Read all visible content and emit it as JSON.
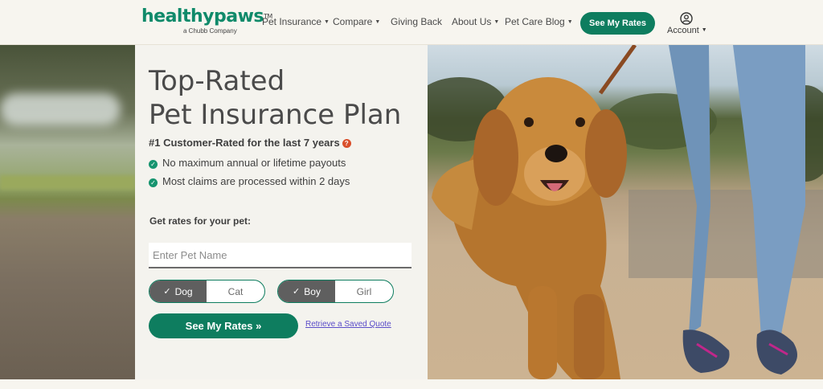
{
  "brand": {
    "logo_text": "healthypaws",
    "logo_tm": "TM",
    "logo_sub": "a Chubb Company"
  },
  "nav": {
    "items": [
      {
        "label": "Pet Insurance",
        "has_caret": true
      },
      {
        "label": "Compare",
        "has_caret": true
      },
      {
        "label": "Giving Back",
        "has_caret": false
      },
      {
        "label": "About Us",
        "has_caret": true
      },
      {
        "label": "Pet Care Blog",
        "has_caret": true
      }
    ],
    "cta_label": "See My Rates",
    "account_label": "Account"
  },
  "hero": {
    "title_line1": "Top-Rated",
    "title_line2": "Pet Insurance Plan",
    "subtitle": "#1 Customer-Rated for the last 7 years",
    "benefits": [
      "No maximum annual or lifetime payouts",
      "Most claims are processed within 2 days"
    ],
    "form_label": "Get rates for your pet:",
    "pet_name_placeholder": "Enter Pet Name",
    "pet_name_value": "",
    "species": {
      "options": [
        "Dog",
        "Cat"
      ],
      "selected": "Dog"
    },
    "gender": {
      "options": [
        "Boy",
        "Girl"
      ],
      "selected": "Boy"
    },
    "submit_label": "See My Rates »",
    "retrieve_label": "Retrieve a Saved Quote"
  },
  "colors": {
    "brand_green": "#0e7d5f",
    "check_green": "#16946f",
    "info_red": "#d94f2b",
    "link_purple": "#5a4cc9",
    "toggle_active": "#5f5f5f"
  }
}
